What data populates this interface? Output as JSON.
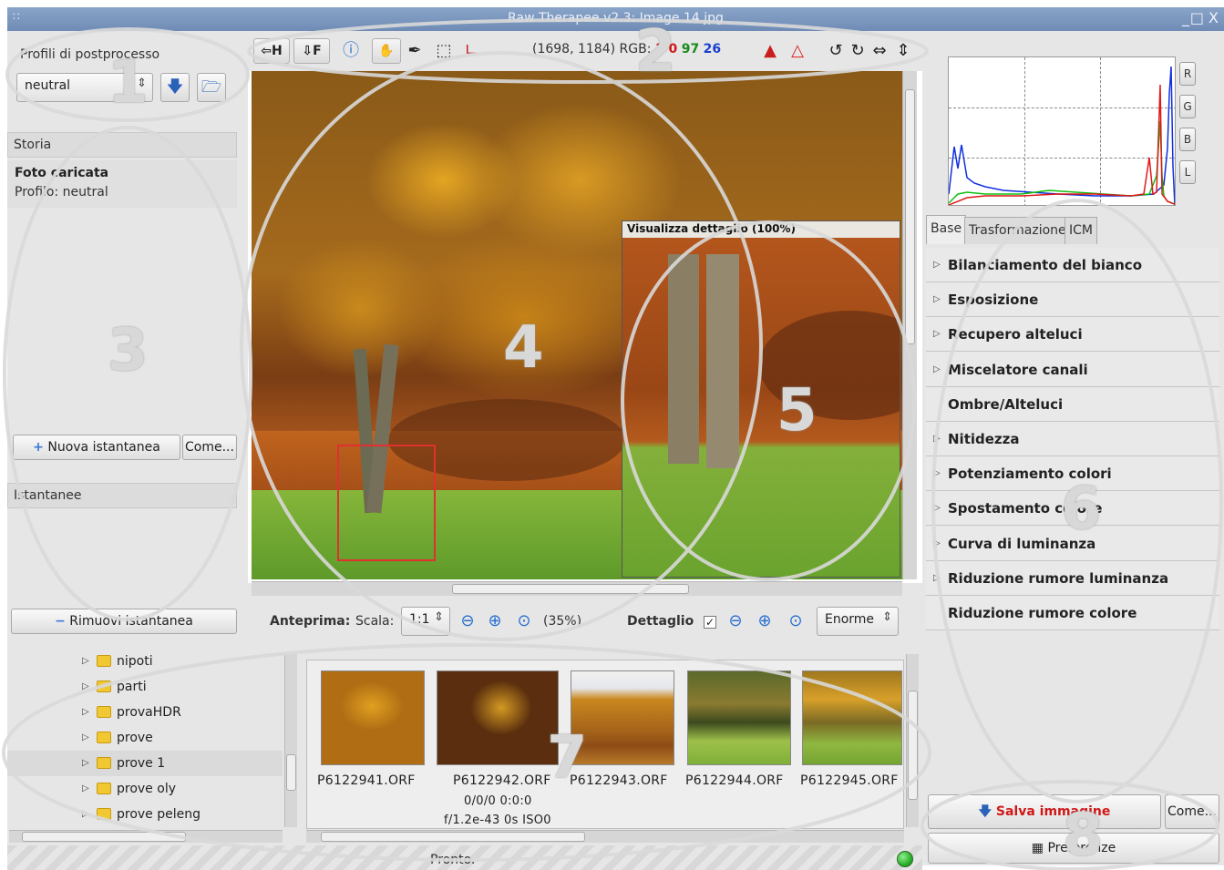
{
  "window": {
    "title": "Raw Therapee v2.3: Image 14.jpg",
    "controls": [
      "_",
      "□",
      "X"
    ]
  },
  "toolbar": {
    "hist_h": "H",
    "hist_f": "F",
    "coords": "(1698, 1184) RGB:",
    "rgb_r": "1 0",
    "rgb_g": "97",
    "rgb_b": "26"
  },
  "profiles": {
    "label": "Profili di postprocesso",
    "selected": "neutral"
  },
  "history": {
    "header": "Storia",
    "item_title": "Foto caricata",
    "item_sub": "Profilo: neutral"
  },
  "snapshots": {
    "new_button": "Nuova istantanea",
    "as_button": "Come...",
    "header": "Istantanee",
    "remove_button": "Rimuovi istantanea"
  },
  "preview": {
    "label": "Anteprima:",
    "scale_label": "Scala:",
    "scale_value": "1:1",
    "zoom": "(35%)",
    "detail_label": "Dettaglio",
    "detail_size": "Enorme",
    "detail_window_title": "Visualizza dettaglio (100%)"
  },
  "folder_tree": [
    {
      "name": "nipoti",
      "selected": false
    },
    {
      "name": "parti",
      "selected": false
    },
    {
      "name": "provaHDR",
      "selected": false
    },
    {
      "name": "prove",
      "selected": false
    },
    {
      "name": "prove 1",
      "selected": true
    },
    {
      "name": "prove oly",
      "selected": false
    },
    {
      "name": "prove peleng",
      "selected": false
    }
  ],
  "thumbnails": [
    {
      "file": "P6122941.ORF"
    },
    {
      "file": "P6122942.ORF",
      "info1": "0/0/0 0:0:0",
      "info2": "f/1.2e-43 0s ISO0"
    },
    {
      "file": "P6122943.ORF"
    },
    {
      "file": "P6122944.ORF"
    },
    {
      "file": "P6122945.ORF"
    }
  ],
  "status": {
    "text": "Pronto."
  },
  "histogram": {
    "buttons": [
      "R",
      "G",
      "B",
      "L"
    ]
  },
  "tabs": [
    "Base",
    "Trasformazione",
    "ICM"
  ],
  "tools": [
    {
      "label": "Bilanciamento del bianco",
      "expandable": true
    },
    {
      "label": "Esposizione",
      "expandable": true
    },
    {
      "label": "Recupero alteluci",
      "expandable": true
    },
    {
      "label": "Miscelatore canali",
      "expandable": true
    },
    {
      "label": "Ombre/Alteluci",
      "expandable": false
    },
    {
      "label": "Nitidezza",
      "expandable": true
    },
    {
      "label": "Potenziamento colori",
      "expandable": true
    },
    {
      "label": "Spostamento colore",
      "expandable": true
    },
    {
      "label": "Curva di luminanza",
      "expandable": true
    },
    {
      "label": "Riduzione rumore luminanza",
      "expandable": true
    },
    {
      "label": "Riduzione rumore colore",
      "expandable": false
    }
  ],
  "save": {
    "save_button": "Salva immagine",
    "as_button": "Come...",
    "prefs_button": "Preferenze"
  },
  "annotations": [
    "1",
    "2",
    "3",
    "4",
    "5",
    "6",
    "7",
    "8"
  ],
  "colors": {
    "accent_red": "#d01818",
    "accent_green": "#1a8a1a",
    "accent_blue": "#1b3fd0",
    "status_ok": "#2bb02b",
    "detail_frame": "#e03030"
  }
}
